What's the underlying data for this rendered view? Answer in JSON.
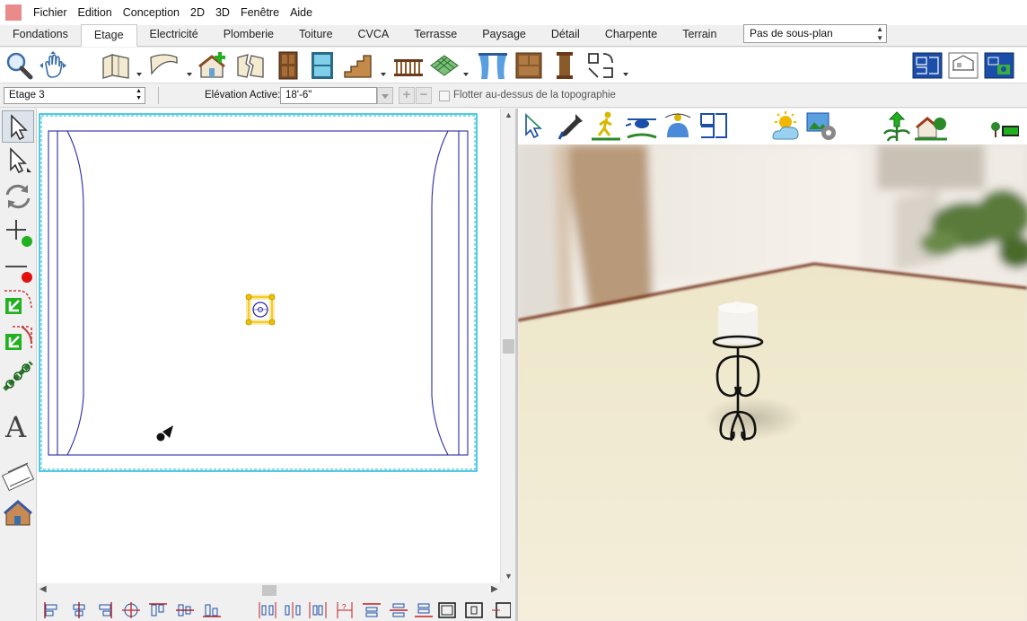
{
  "menu": [
    "Fichier",
    "Edition",
    "Conception",
    "2D",
    "3D",
    "Fenêtre",
    "Aide"
  ],
  "tabs": [
    "Fondations",
    "Etage",
    "Electricité",
    "Plomberie",
    "Toiture",
    "CVCA",
    "Terrasse",
    "Paysage",
    "Détail",
    "Charpente",
    "Terrain"
  ],
  "active_tab": "Etage",
  "subplan_select": "Pas de sous-plan",
  "floor_select": "Etage 3",
  "elevation": {
    "label": "Elévation Active:",
    "value": "18'-6\""
  },
  "float_checkbox": {
    "label": "Flotter au-dessus de la topographie",
    "checked": false
  },
  "colors": {
    "selection_handle": "#f2c200",
    "plan_line": "#2a2aa8",
    "boundary": "#19b8d8",
    "accent_green": "#20b020",
    "delete_red": "#e01010"
  },
  "main_toolbar_icons": [
    "zoom-icon",
    "pan-hand-icon",
    "wall-icon",
    "curved-wall-icon",
    "add-house-icon",
    "break-wall-icon",
    "door-icon",
    "window-icon",
    "stairs-icon",
    "railing-icon",
    "floor-pattern-icon",
    "curtain-icon",
    "cabinet-icon",
    "column-icon",
    "shape-tools-icon",
    "plan-view-icon",
    "elevation-view-icon",
    "camera-plan-icon"
  ],
  "left_toolbar_icons": [
    "select-arrow-icon",
    "edit-arrow-icon",
    "rotate-icon",
    "add-point-icon",
    "delete-point-icon",
    "join-icon",
    "fillet-icon",
    "chain-icon",
    "text-icon",
    "film-icon",
    "house-icon"
  ],
  "view3d_toolbar_icons": [
    "select-3d-icon",
    "eyedropper-icon",
    "walk-icon",
    "fly-icon",
    "orbit-icon",
    "room-layout-icon",
    "sun-icon",
    "render-settings-icon",
    "plant-icon",
    "house-landscape-icon",
    "tree-toggle-icon"
  ]
}
